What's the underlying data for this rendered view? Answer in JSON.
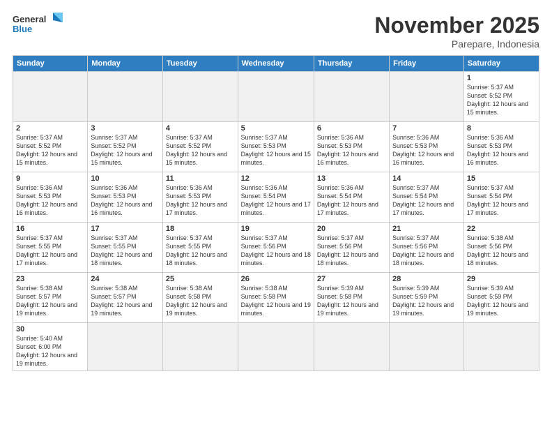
{
  "header": {
    "logo_general": "General",
    "logo_blue": "Blue",
    "month_title": "November 2025",
    "location": "Parepare, Indonesia"
  },
  "weekdays": [
    "Sunday",
    "Monday",
    "Tuesday",
    "Wednesday",
    "Thursday",
    "Friday",
    "Saturday"
  ],
  "days": [
    {
      "num": "",
      "sunrise": "",
      "sunset": "",
      "daylight": "",
      "empty": true
    },
    {
      "num": "",
      "sunrise": "",
      "sunset": "",
      "daylight": "",
      "empty": true
    },
    {
      "num": "",
      "sunrise": "",
      "sunset": "",
      "daylight": "",
      "empty": true
    },
    {
      "num": "",
      "sunrise": "",
      "sunset": "",
      "daylight": "",
      "empty": true
    },
    {
      "num": "",
      "sunrise": "",
      "sunset": "",
      "daylight": "",
      "empty": true
    },
    {
      "num": "",
      "sunrise": "",
      "sunset": "",
      "daylight": "",
      "empty": true
    },
    {
      "num": "1",
      "sunrise": "Sunrise: 5:37 AM",
      "sunset": "Sunset: 5:52 PM",
      "daylight": "Daylight: 12 hours and 15 minutes.",
      "empty": false
    },
    {
      "num": "2",
      "sunrise": "Sunrise: 5:37 AM",
      "sunset": "Sunset: 5:52 PM",
      "daylight": "Daylight: 12 hours and 15 minutes.",
      "empty": false
    },
    {
      "num": "3",
      "sunrise": "Sunrise: 5:37 AM",
      "sunset": "Sunset: 5:52 PM",
      "daylight": "Daylight: 12 hours and 15 minutes.",
      "empty": false
    },
    {
      "num": "4",
      "sunrise": "Sunrise: 5:37 AM",
      "sunset": "Sunset: 5:52 PM",
      "daylight": "Daylight: 12 hours and 15 minutes.",
      "empty": false
    },
    {
      "num": "5",
      "sunrise": "Sunrise: 5:37 AM",
      "sunset": "Sunset: 5:53 PM",
      "daylight": "Daylight: 12 hours and 15 minutes.",
      "empty": false
    },
    {
      "num": "6",
      "sunrise": "Sunrise: 5:36 AM",
      "sunset": "Sunset: 5:53 PM",
      "daylight": "Daylight: 12 hours and 16 minutes.",
      "empty": false
    },
    {
      "num": "7",
      "sunrise": "Sunrise: 5:36 AM",
      "sunset": "Sunset: 5:53 PM",
      "daylight": "Daylight: 12 hours and 16 minutes.",
      "empty": false
    },
    {
      "num": "8",
      "sunrise": "Sunrise: 5:36 AM",
      "sunset": "Sunset: 5:53 PM",
      "daylight": "Daylight: 12 hours and 16 minutes.",
      "empty": false
    },
    {
      "num": "9",
      "sunrise": "Sunrise: 5:36 AM",
      "sunset": "Sunset: 5:53 PM",
      "daylight": "Daylight: 12 hours and 16 minutes.",
      "empty": false
    },
    {
      "num": "10",
      "sunrise": "Sunrise: 5:36 AM",
      "sunset": "Sunset: 5:53 PM",
      "daylight": "Daylight: 12 hours and 16 minutes.",
      "empty": false
    },
    {
      "num": "11",
      "sunrise": "Sunrise: 5:36 AM",
      "sunset": "Sunset: 5:53 PM",
      "daylight": "Daylight: 12 hours and 17 minutes.",
      "empty": false
    },
    {
      "num": "12",
      "sunrise": "Sunrise: 5:36 AM",
      "sunset": "Sunset: 5:54 PM",
      "daylight": "Daylight: 12 hours and 17 minutes.",
      "empty": false
    },
    {
      "num": "13",
      "sunrise": "Sunrise: 5:36 AM",
      "sunset": "Sunset: 5:54 PM",
      "daylight": "Daylight: 12 hours and 17 minutes.",
      "empty": false
    },
    {
      "num": "14",
      "sunrise": "Sunrise: 5:37 AM",
      "sunset": "Sunset: 5:54 PM",
      "daylight": "Daylight: 12 hours and 17 minutes.",
      "empty": false
    },
    {
      "num": "15",
      "sunrise": "Sunrise: 5:37 AM",
      "sunset": "Sunset: 5:54 PM",
      "daylight": "Daylight: 12 hours and 17 minutes.",
      "empty": false
    },
    {
      "num": "16",
      "sunrise": "Sunrise: 5:37 AM",
      "sunset": "Sunset: 5:55 PM",
      "daylight": "Daylight: 12 hours and 17 minutes.",
      "empty": false
    },
    {
      "num": "17",
      "sunrise": "Sunrise: 5:37 AM",
      "sunset": "Sunset: 5:55 PM",
      "daylight": "Daylight: 12 hours and 18 minutes.",
      "empty": false
    },
    {
      "num": "18",
      "sunrise": "Sunrise: 5:37 AM",
      "sunset": "Sunset: 5:55 PM",
      "daylight": "Daylight: 12 hours and 18 minutes.",
      "empty": false
    },
    {
      "num": "19",
      "sunrise": "Sunrise: 5:37 AM",
      "sunset": "Sunset: 5:56 PM",
      "daylight": "Daylight: 12 hours and 18 minutes.",
      "empty": false
    },
    {
      "num": "20",
      "sunrise": "Sunrise: 5:37 AM",
      "sunset": "Sunset: 5:56 PM",
      "daylight": "Daylight: 12 hours and 18 minutes.",
      "empty": false
    },
    {
      "num": "21",
      "sunrise": "Sunrise: 5:37 AM",
      "sunset": "Sunset: 5:56 PM",
      "daylight": "Daylight: 12 hours and 18 minutes.",
      "empty": false
    },
    {
      "num": "22",
      "sunrise": "Sunrise: 5:38 AM",
      "sunset": "Sunset: 5:56 PM",
      "daylight": "Daylight: 12 hours and 18 minutes.",
      "empty": false
    },
    {
      "num": "23",
      "sunrise": "Sunrise: 5:38 AM",
      "sunset": "Sunset: 5:57 PM",
      "daylight": "Daylight: 12 hours and 19 minutes.",
      "empty": false
    },
    {
      "num": "24",
      "sunrise": "Sunrise: 5:38 AM",
      "sunset": "Sunset: 5:57 PM",
      "daylight": "Daylight: 12 hours and 19 minutes.",
      "empty": false
    },
    {
      "num": "25",
      "sunrise": "Sunrise: 5:38 AM",
      "sunset": "Sunset: 5:58 PM",
      "daylight": "Daylight: 12 hours and 19 minutes.",
      "empty": false
    },
    {
      "num": "26",
      "sunrise": "Sunrise: 5:38 AM",
      "sunset": "Sunset: 5:58 PM",
      "daylight": "Daylight: 12 hours and 19 minutes.",
      "empty": false
    },
    {
      "num": "27",
      "sunrise": "Sunrise: 5:39 AM",
      "sunset": "Sunset: 5:58 PM",
      "daylight": "Daylight: 12 hours and 19 minutes.",
      "empty": false
    },
    {
      "num": "28",
      "sunrise": "Sunrise: 5:39 AM",
      "sunset": "Sunset: 5:59 PM",
      "daylight": "Daylight: 12 hours and 19 minutes.",
      "empty": false
    },
    {
      "num": "29",
      "sunrise": "Sunrise: 5:39 AM",
      "sunset": "Sunset: 5:59 PM",
      "daylight": "Daylight: 12 hours and 19 minutes.",
      "empty": false
    },
    {
      "num": "30",
      "sunrise": "Sunrise: 5:40 AM",
      "sunset": "Sunset: 6:00 PM",
      "daylight": "Daylight: 12 hours and 19 minutes.",
      "empty": false
    },
    {
      "num": "",
      "sunrise": "",
      "sunset": "",
      "daylight": "",
      "empty": true
    },
    {
      "num": "",
      "sunrise": "",
      "sunset": "",
      "daylight": "",
      "empty": true
    },
    {
      "num": "",
      "sunrise": "",
      "sunset": "",
      "daylight": "",
      "empty": true
    },
    {
      "num": "",
      "sunrise": "",
      "sunset": "",
      "daylight": "",
      "empty": true
    },
    {
      "num": "",
      "sunrise": "",
      "sunset": "",
      "daylight": "",
      "empty": true
    },
    {
      "num": "",
      "sunrise": "",
      "sunset": "",
      "daylight": "",
      "empty": true
    }
  ]
}
